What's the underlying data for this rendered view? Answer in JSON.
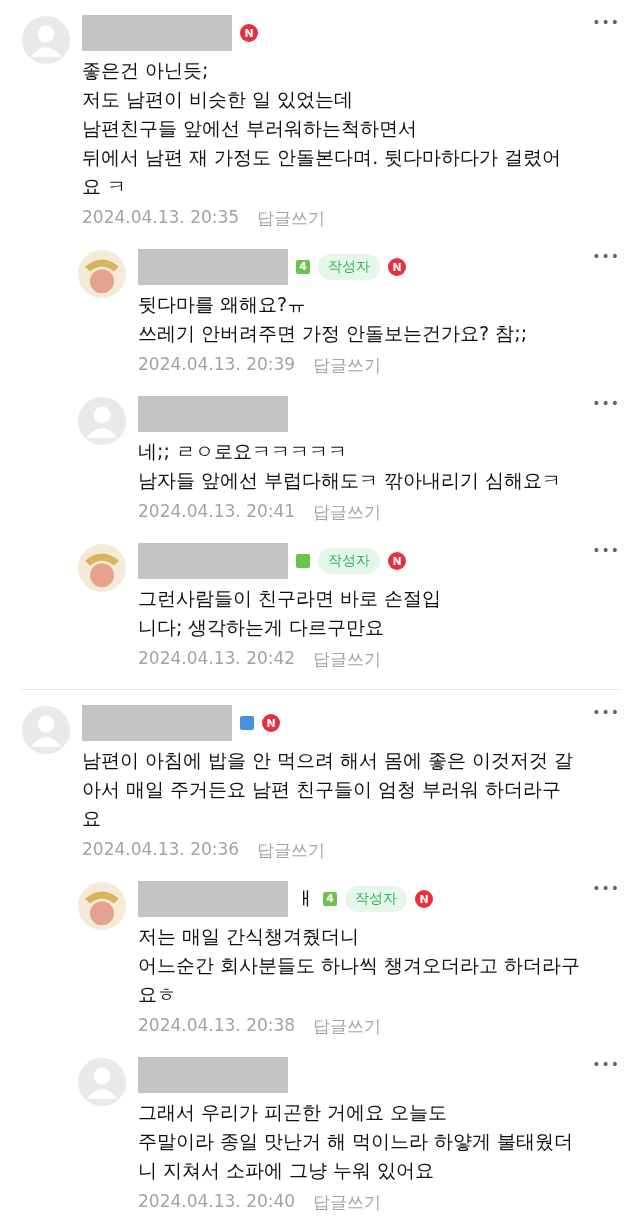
{
  "threads": [
    {
      "avatar": {
        "kind": "default"
      },
      "author": false,
      "new": true,
      "new_label": "N",
      "more": "•••",
      "lines": [
        "좋은건 아닌듯;",
        "저도 남편이 비슷한 일 있었는데",
        "남편친구들 앞에선 부러워하는척하면서",
        "뒤에서 남편 재 가정도 안돌본다며. 뒷다마하다가 걸렸어",
        "요 ㅋ"
      ],
      "date": "2024.04.13. 20:35",
      "reply_label": "답글쓰기",
      "replies": [
        {
          "avatar": {
            "kind": "photo"
          },
          "level_badge": {
            "color": "#6cc24a",
            "label": "4"
          },
          "author": true,
          "author_label": "작성자",
          "new": true,
          "new_label": "N",
          "more": "•••",
          "lines": [
            "뒷다마를 왜해요?ㅠ",
            "쓰레기 안버려주면 가정 안돌보는건가요? 참;;"
          ],
          "date": "2024.04.13. 20:39",
          "reply_label": "답글쓰기"
        },
        {
          "avatar": {
            "kind": "default"
          },
          "author": false,
          "new": false,
          "more": "•••",
          "lines": [
            "네;; ㄹㅇ로요ㅋㅋㅋㅋㅋ",
            "남자들 앞에선 부럽다해도ㅋ 깎아내리기 심해요ㅋ"
          ],
          "date": "2024.04.13. 20:41",
          "reply_label": "답글쓰기"
        },
        {
          "avatar": {
            "kind": "photo"
          },
          "level_badge": {
            "color": "#6cc24a"
          },
          "author": true,
          "author_label": "작성자",
          "new": true,
          "new_label": "N",
          "more": "•••",
          "lines": [
            "그런사람들이 친구라면 바로 손절입",
            "니다; 생각하는게 다르구만요"
          ],
          "date": "2024.04.13. 20:42",
          "reply_label": "답글쓰기"
        }
      ]
    },
    {
      "avatar": {
        "kind": "default"
      },
      "level_badge": {
        "color": "#4a90e2"
      },
      "author": false,
      "new": true,
      "new_label": "N",
      "more": "•••",
      "lines": [
        "남편이 아침에 밥을 안 먹으려 해서 몸에 좋은 이것저것 갈",
        "아서 매일 주거든요 남편 친구들이 엄청 부러워 하더라구",
        "요"
      ],
      "date": "2024.04.13. 20:36",
      "reply_label": "답글쓰기",
      "replies": [
        {
          "avatar": {
            "kind": "photo"
          },
          "name_tail": "ㅐ",
          "level_badge": {
            "color": "#6cc24a",
            "label": "4"
          },
          "author": true,
          "author_label": "작성자",
          "new": true,
          "new_label": "N",
          "more": "•••",
          "lines": [
            "저는 매일 간식챙겨줬더니",
            "어느순간 회사분들도 하나씩 챙겨오더라고 하더라구",
            "요ㅎ"
          ],
          "date": "2024.04.13. 20:38",
          "reply_label": "답글쓰기"
        },
        {
          "avatar": {
            "kind": "default"
          },
          "author": false,
          "new": false,
          "more": "•••",
          "lines": [
            "그래서 우리가 피곤한 거에요 오늘도",
            "주말이라 종일 맛난거 해 먹이느라 하얗게 불태웠더",
            "니 지쳐서 소파에 그냥 누워 있어요"
          ],
          "date": "2024.04.13. 20:40",
          "reply_label": "답글쓰기"
        }
      ]
    }
  ]
}
